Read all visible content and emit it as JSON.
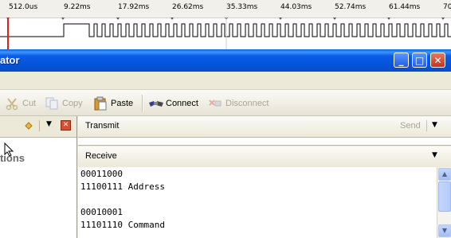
{
  "timeline": {
    "ticks": [
      "512.0us",
      "9.22ms",
      "17.92ms",
      "26.62ms",
      "35.33ms",
      "44.03ms",
      "52.74ms",
      "61.44ms",
      "70"
    ]
  },
  "window": {
    "title_fragment": "ator",
    "buttons": {
      "minimize": "_",
      "maximize": "□",
      "close": "✕"
    }
  },
  "toolbar": {
    "cut_label": "Cut",
    "copy_label": "Copy",
    "paste_label": "Paste",
    "connect_label": "Connect",
    "disconnect_label": "Disconnect"
  },
  "left_pane": {
    "options_fragment": "otions"
  },
  "transmit": {
    "label": "Transmit",
    "send_label": "Send"
  },
  "receive": {
    "label": "Receive",
    "lines": [
      "00011000",
      "11100111 Address",
      "",
      "00010001",
      "11101110 Command"
    ]
  },
  "colors": {
    "titlebar": "#0a5ce8",
    "marker": "#e0201a",
    "background": "#ece9d8"
  }
}
